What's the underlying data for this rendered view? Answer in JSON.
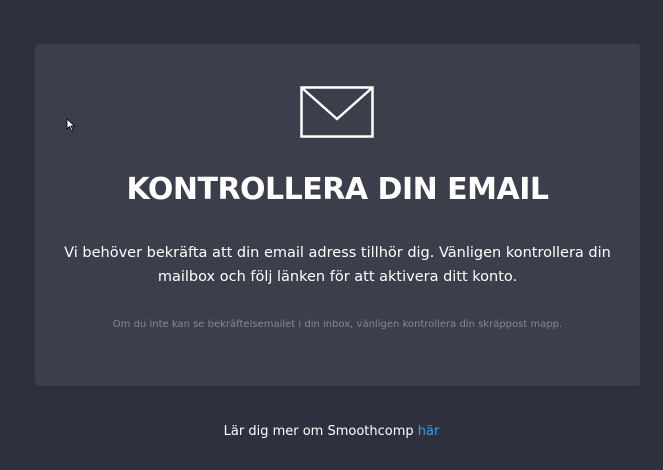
{
  "card": {
    "title": "KONTROLLERA DIN EMAIL",
    "description": "Vi behöver bekräfta att din email adress tillhör dig. Vänligen kontrollera din mailbox och följ länken för att aktivera ditt konto.",
    "note": "Om du inte kan se bekräftelsemailet i din inbox, vänligen kontrollera din skräppost mapp.",
    "icon": "envelope-icon"
  },
  "footer": {
    "text": "Lär dig mer om Smoothcomp ",
    "link_label": "här"
  },
  "colors": {
    "background": "#2e303d",
    "card": "#3b3e4b",
    "link": "#2ba6e0",
    "muted_text": "#868896"
  }
}
